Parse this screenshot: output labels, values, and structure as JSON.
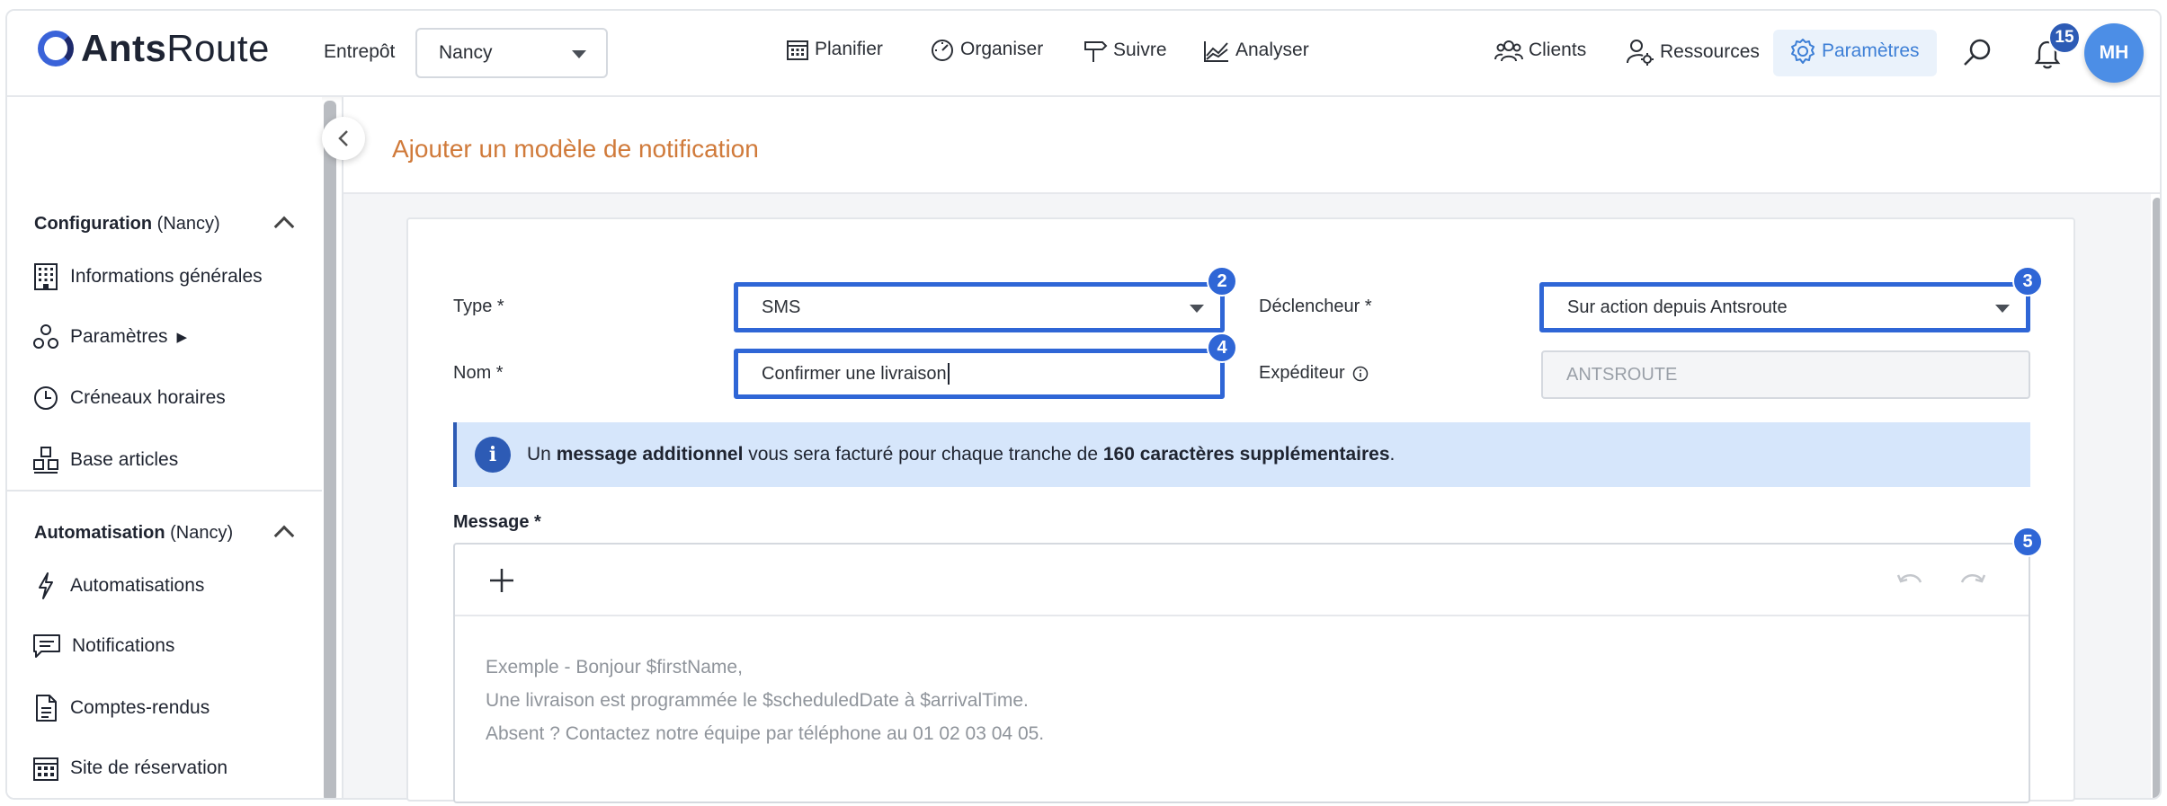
{
  "app": {
    "logo_bold": "Ants",
    "logo_light": "Route"
  },
  "header": {
    "entrepot_label": "Entrepôt",
    "entrepot_value": "Nancy",
    "nav_center": [
      "Planifier",
      "Organiser",
      "Suivre",
      "Analyser"
    ],
    "nav_right": [
      "Clients",
      "Ressources",
      "Paramètres"
    ],
    "notifications_count": "15",
    "avatar_initials": "MH"
  },
  "sidebar": {
    "config_title": "Configuration",
    "config_context": "(Nancy)",
    "config_items": [
      "Informations générales",
      "Paramètres",
      "Créneaux horaires",
      "Base articles"
    ],
    "params_arrow": "▶",
    "auto_title": "Automatisation",
    "auto_context": "(Nancy)",
    "auto_items": [
      "Automatisations",
      "Notifications",
      "Comptes-rendus",
      "Site de réservation"
    ]
  },
  "page": {
    "title": "Ajouter un modèle de notification"
  },
  "form": {
    "type_label": "Type *",
    "type_value": "SMS",
    "trigger_label": "Déclencheur *",
    "trigger_value": "Sur action depuis Antsroute",
    "name_label": "Nom *",
    "name_value": "Confirmer une livraison",
    "sender_label": "Expéditeur",
    "sender_value": "ANTSROUTE",
    "markers": [
      "2",
      "3",
      "4",
      "5"
    ]
  },
  "info": {
    "icon": "i",
    "part1": "Un ",
    "bold1": "message additionnel",
    "part2": " vous sera facturé pour chaque tranche de ",
    "bold2": "160 caractères supplémentaires",
    "part3": "."
  },
  "message": {
    "label": "Message *",
    "placeholder_lines": [
      "Exemple - Bonjour $firstName,",
      "Une livraison est programmée le $scheduledDate à $arrivalTime.",
      "Absent ? Contactez notre équipe par téléphone au 01 02 03 04 05."
    ]
  },
  "colors": {
    "accent": "#2f66d6",
    "title": "#d07a3a",
    "info_bg": "#d6e6fb"
  }
}
